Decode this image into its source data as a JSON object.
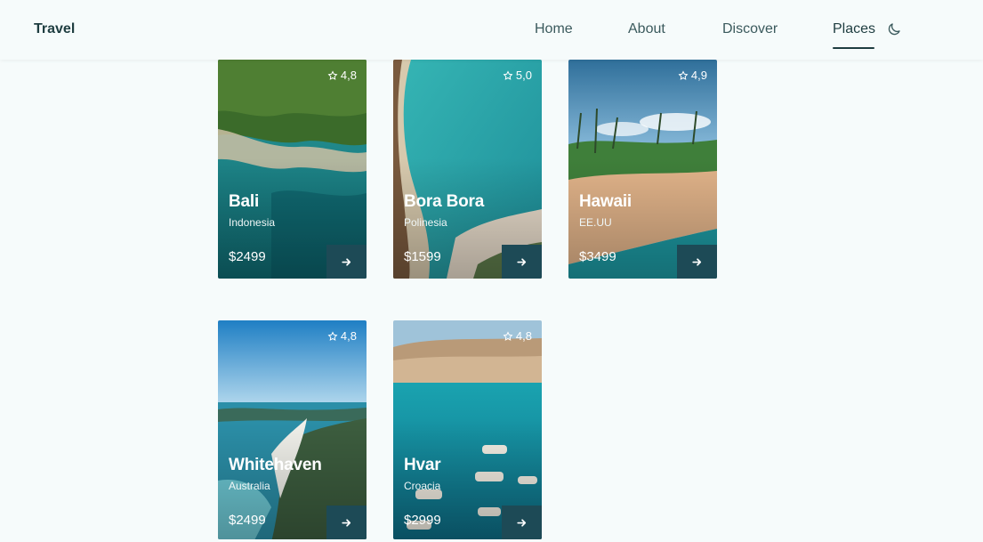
{
  "header": {
    "logo": "Travel",
    "nav": [
      {
        "label": "Home",
        "active": false
      },
      {
        "label": "About",
        "active": false
      },
      {
        "label": "Discover",
        "active": false
      },
      {
        "label": "Places",
        "active": true
      }
    ],
    "theme_toggle_icon": "moon-icon"
  },
  "places": [
    {
      "rating": "4,8",
      "title": "Bali",
      "country": "Indonesia",
      "price": "$2499"
    },
    {
      "rating": "5,0",
      "title": "Bora Bora",
      "country": "Polinesia",
      "price": "$1599"
    },
    {
      "rating": "4,9",
      "title": "Hawaii",
      "country": "EE.UU",
      "price": "$3499"
    },
    {
      "rating": "4,8",
      "title": "Whitehaven",
      "country": "Australia",
      "price": "$2499"
    },
    {
      "rating": "4,8",
      "title": "Hvar",
      "country": "Croacia",
      "price": "$2999"
    }
  ],
  "colors": {
    "background": "#f6fbfb",
    "text_dark": "#1e3d40",
    "button": "#1d4a56"
  }
}
